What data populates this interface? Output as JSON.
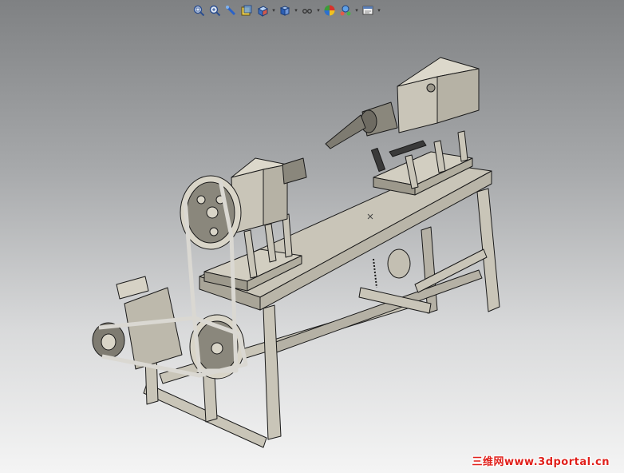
{
  "toolbar": {
    "items": [
      {
        "icon": "zoom-to-fit-icon"
      },
      {
        "icon": "zoom-to-area-icon"
      },
      {
        "icon": "previous-view-icon"
      },
      {
        "icon": "section-view-icon"
      },
      {
        "icon": "view-orientation-icon",
        "dropdown": true
      },
      {
        "icon": "display-style-icon",
        "dropdown": true
      },
      {
        "icon": "hide-show-items-icon",
        "dropdown": true
      },
      {
        "icon": "edit-appearance-icon"
      },
      {
        "icon": "apply-scene-icon",
        "dropdown": true
      },
      {
        "icon": "view-settings-icon",
        "dropdown": true
      }
    ]
  },
  "colors": {
    "background_top": "#7f8183",
    "background_bottom": "#f4f4f4",
    "part_face": "#c9c5b8",
    "part_dark": "#8e8b80",
    "edge": "#1a1a1a"
  },
  "watermark": {
    "text": "三维网www.3dportal.cn"
  }
}
